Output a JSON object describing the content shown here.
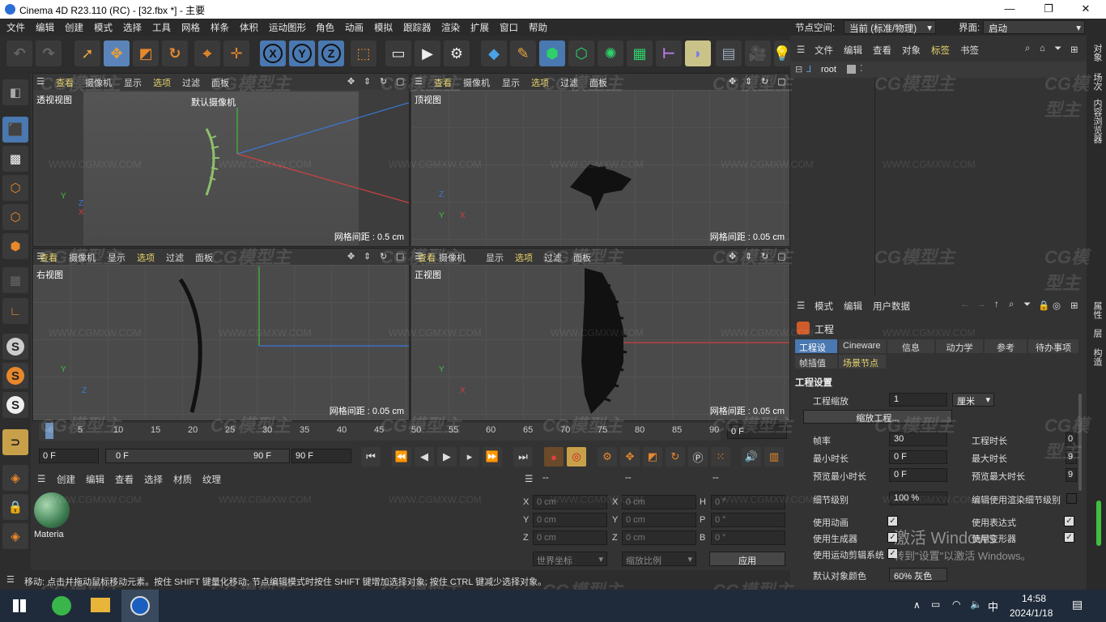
{
  "window": {
    "title": "Cinema 4D R23.110 (RC) - [32.fbx *] - 主要"
  },
  "menu": [
    "文件",
    "编辑",
    "创建",
    "模式",
    "选择",
    "工具",
    "网格",
    "样条",
    "体积",
    "运动图形",
    "角色",
    "动画",
    "模拟",
    "跟踪器",
    "渲染",
    "扩展",
    "窗口",
    "帮助"
  ],
  "node_space": {
    "label": "节点空间:",
    "value": "当前 (标准/物理)"
  },
  "interface": {
    "label": "界面:",
    "value": "启动"
  },
  "toolbar": {
    "axis_x": "X",
    "axis_y": "Y",
    "axis_z": "Z"
  },
  "viewport_menu": [
    "查看",
    "摄像机",
    "显示",
    "选项",
    "过滤",
    "面板"
  ],
  "viewports": {
    "perspective": {
      "name": "透视视图",
      "camera": "默认摄像机",
      "spacing": "网格间距 : 0.5 cm"
    },
    "top": {
      "name": "顶视图",
      "spacing": "网格间距 : 0.05 cm"
    },
    "right": {
      "name": "右视图",
      "spacing": "网格间距 : 0.05 cm"
    },
    "front": {
      "name": "正视图",
      "spacing": "网格间距 : 0.05 cm"
    }
  },
  "timeline": {
    "ticks": [
      "0",
      "5",
      "10",
      "15",
      "20",
      "25",
      "30",
      "35",
      "40",
      "45",
      "50",
      "55",
      "60",
      "65",
      "70",
      "75",
      "80",
      "85",
      "90"
    ],
    "current_frame": "0 F",
    "range_start": "0 F",
    "range_start_inner": "0 F",
    "range_end_inner": "90 F",
    "range_end": "90 F",
    "end_field": "0 F"
  },
  "material_panel": {
    "menu": [
      "创建",
      "编辑",
      "查看",
      "选择",
      "材质",
      "纹理"
    ],
    "material_name": "Materia"
  },
  "coord_panel": {
    "header": [
      "--",
      "--",
      "--"
    ],
    "rows": [
      {
        "l1": "X",
        "v1": "0 cm",
        "l2": "X",
        "v2": "0 cm",
        "l3": "H",
        "v3": "0 °"
      },
      {
        "l1": "Y",
        "v1": "0 cm",
        "l2": "Y",
        "v2": "0 cm",
        "l3": "P",
        "v3": "0 °"
      },
      {
        "l1": "Z",
        "v1": "0 cm",
        "l2": "Z",
        "v2": "0 cm",
        "l3": "B",
        "v3": "0 °"
      }
    ],
    "world": "世界坐标",
    "scale": "缩放比例",
    "apply": "应用"
  },
  "status": "移动: 点击并拖动鼠标移动元素。按住 SHIFT 键量化移动; 节点编辑模式时按住 SHIFT 键增加选择对象; 按住 CTRL 键减少选择对象。",
  "object_manager": {
    "menu": [
      "文件",
      "编辑",
      "查看",
      "对象",
      "标签",
      "书签"
    ],
    "root": "root"
  },
  "attributes": {
    "menu": [
      "模式",
      "编辑",
      "用户数据"
    ],
    "title": "工程",
    "tabs_row1": [
      "工程设置",
      "Cineware",
      "信息",
      "动力学",
      "参考",
      "待办事项"
    ],
    "tabs_row2": [
      "帧插值",
      "场景节点"
    ],
    "section": "工程设置",
    "scale_label": "工程缩放",
    "scale_value": "1",
    "scale_unit": "厘米",
    "scale_button": "缩放工程...",
    "fps_label": "帧率",
    "fps_value": "30",
    "duration_label": "工程时长",
    "duration_value": "0",
    "min_label": "最小时长",
    "min_value": "0 F",
    "max_label": "最大时长",
    "max_value": "9",
    "pmin_label": "预览最小时长",
    "pmin_value": "0 F",
    "pmax_label": "预览最大时长",
    "pmax_value": "9",
    "lod_label": "细节级别",
    "lod_value": "100 %",
    "render_lod_label": "编辑使用渲染细节级别",
    "use_anim": "使用动画",
    "use_expr": "使用表达式",
    "use_gen": "使用生成器",
    "use_deform": "使用变形器",
    "use_motion": "使用运动剪辑系统",
    "obj_color": "默认对象颜色",
    "obj_color_value": "60% 灰色"
  },
  "right_tabs": [
    "对象",
    "场次",
    "内容浏览器",
    "属性",
    "层",
    "构造"
  ],
  "activation": {
    "line1": "激活 Windows",
    "line2": "转到\"设置\"以激活 Windows。"
  },
  "watermark": {
    "logo": "CG模型主",
    "url": "WWW.CGMXW.COM"
  },
  "taskbar": {
    "time": "14:58",
    "date": "2024/1/18",
    "ime": "中"
  }
}
